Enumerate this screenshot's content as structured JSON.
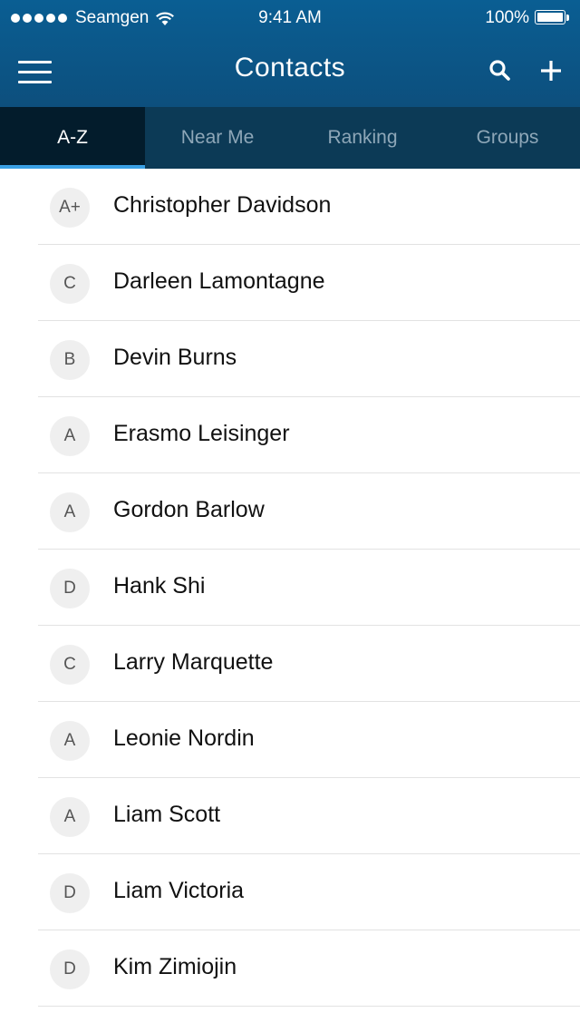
{
  "status_bar": {
    "carrier": "Seamgen",
    "time": "9:41 AM",
    "battery": "100%",
    "signal_icon": "signal-dots-icon",
    "wifi_icon": "wifi-icon",
    "battery_icon": "battery-icon"
  },
  "nav": {
    "title": "Contacts",
    "menu_icon": "hamburger-menu-icon",
    "search_icon": "search-icon",
    "add_icon": "plus-icon"
  },
  "tabs": [
    {
      "label": "A-Z",
      "active": true
    },
    {
      "label": "Near Me",
      "active": false
    },
    {
      "label": "Ranking",
      "active": false
    },
    {
      "label": "Groups",
      "active": false
    }
  ],
  "contacts": [
    {
      "grade": "A+",
      "name": "Christopher Davidson"
    },
    {
      "grade": "C",
      "name": "Darleen Lamontagne"
    },
    {
      "grade": "B",
      "name": "Devin Burns"
    },
    {
      "grade": "A",
      "name": "Erasmo Leisinger"
    },
    {
      "grade": "A",
      "name": "Gordon Barlow"
    },
    {
      "grade": "D",
      "name": "Hank Shi"
    },
    {
      "grade": "C",
      "name": "Larry Marquette"
    },
    {
      "grade": "A",
      "name": "Leonie Nordin"
    },
    {
      "grade": "A",
      "name": "Liam Scott"
    },
    {
      "grade": "D",
      "name": "Liam Victoria"
    },
    {
      "grade": "D",
      "name": "Kim Zimiojin"
    }
  ],
  "colors": {
    "header": "#0a5e93",
    "tab_bar": "#0c3a56",
    "active_tab": "#031c2c",
    "accent": "#3aa0e4"
  }
}
